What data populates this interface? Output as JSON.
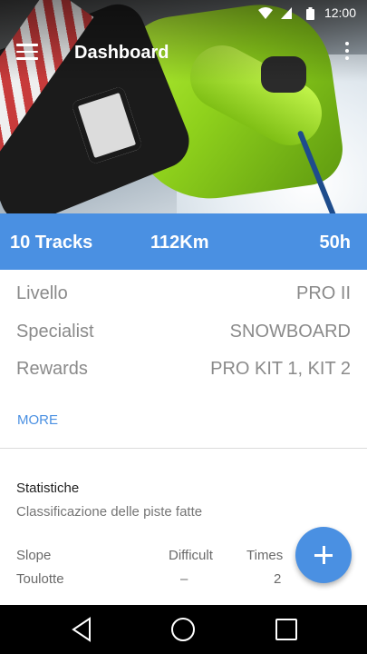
{
  "status_bar": {
    "time": "12:00",
    "icons": [
      "wifi-icon",
      "signal-icon",
      "battery-icon"
    ]
  },
  "toolbar": {
    "title": "Dashboard",
    "menu_icon": "hamburger-menu-icon",
    "overflow_icon": "more-vertical-icon"
  },
  "summary": {
    "tracks": "10 Tracks",
    "distance": "112Km",
    "hours": "50h",
    "color": "#4a90e2"
  },
  "profile": [
    {
      "label": "Livello",
      "value": "PRO II"
    },
    {
      "label": "Specialist",
      "value": "SNOWBOARD"
    },
    {
      "label": "Rewards",
      "value": "PRO KIT 1,  KIT 2"
    }
  ],
  "more_link": "MORE",
  "statistics": {
    "title": "Statistiche",
    "subtitle": "Classificazione delle piste fatte",
    "columns": [
      "Slope",
      "Difficult",
      "Times"
    ],
    "rows": [
      [
        "Toulotte",
        "–",
        "2"
      ]
    ]
  },
  "fab": {
    "icon": "plus-icon"
  },
  "nav": {
    "back_icon": "back-triangle-icon",
    "home_icon": "home-circle-icon",
    "recents_icon": "recents-square-icon"
  }
}
